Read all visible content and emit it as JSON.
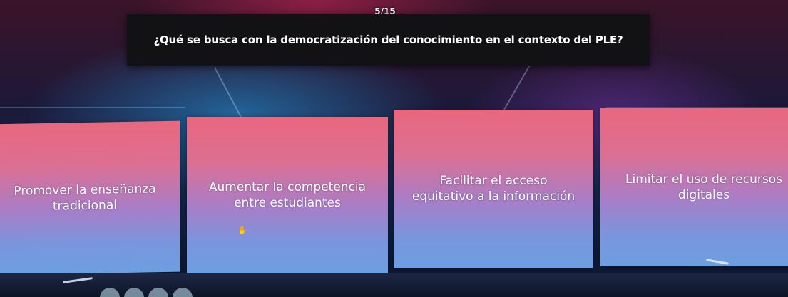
{
  "progress": {
    "counter": "5/15"
  },
  "question": {
    "text": "¿Qué se busca con la democratización del conocimiento en el contexto del PLE?"
  },
  "answers": [
    {
      "label": "Promover la enseñanza\ntradicional"
    },
    {
      "label": "Aumentar la competencia\nentre estudiantes"
    },
    {
      "label": "Facilitar el acceso\nequitativo a la información"
    },
    {
      "label": "Limitar el uso de recursos\ndigitales"
    }
  ],
  "colors": {
    "card_top": "#e9677f",
    "card_bottom": "#6c9fe0",
    "question_bg": "#121214"
  },
  "icons": {
    "cursor": "hand-pointer-icon"
  }
}
